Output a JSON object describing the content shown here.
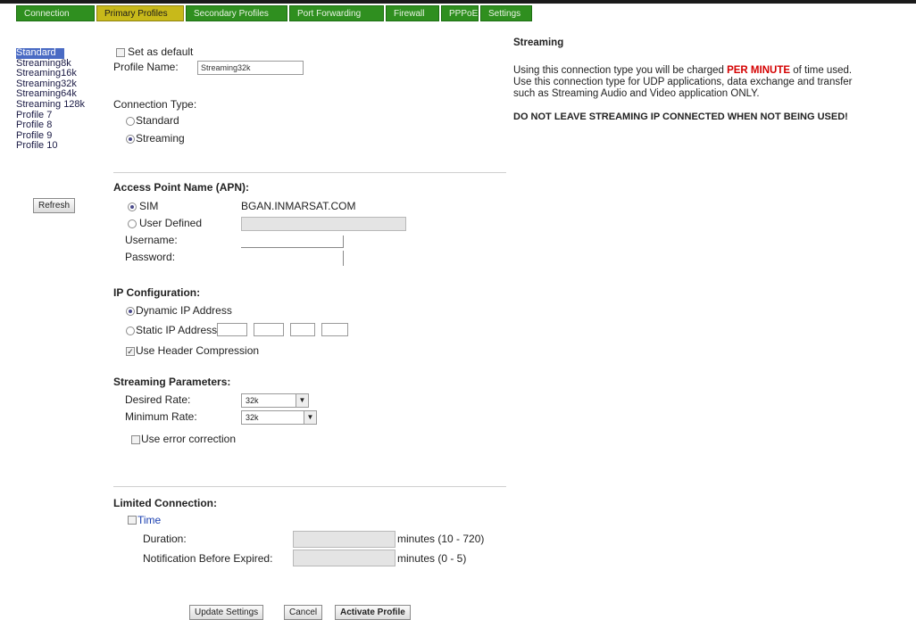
{
  "nav": {
    "tabs": [
      {
        "label": "Connection"
      },
      {
        "label": "Primary Profiles"
      },
      {
        "label": "Secondary Profiles"
      },
      {
        "label": "Port Forwarding"
      },
      {
        "label": "Firewall"
      },
      {
        "label": "PPPoE"
      },
      {
        "label": "Settings"
      }
    ]
  },
  "sidebar": {
    "items": [
      {
        "label": "Standard"
      },
      {
        "label": "Streaming8k"
      },
      {
        "label": "Streaming16k"
      },
      {
        "label": "Streaming32k"
      },
      {
        "label": "Streaming64k"
      },
      {
        "label": "Streaming 128k"
      },
      {
        "label": "Profile 7"
      },
      {
        "label": "Profile 8"
      },
      {
        "label": "Profile 9"
      },
      {
        "label": "Profile 10"
      }
    ],
    "refresh_label": "Refresh"
  },
  "form": {
    "set_default_label": "Set as default",
    "profile_name_label": "Profile Name:",
    "profile_name_value": "Streaming32k",
    "connection_type_label": "Connection Type:",
    "standard_label": "Standard",
    "streaming_label": "Streaming",
    "apn_heading": "Access Point Name (APN):",
    "sim_label": "SIM",
    "sim_value": "BGAN.INMARSAT.COM",
    "user_defined_label": "User Defined",
    "username_label": "Username:",
    "password_label": "Password:",
    "ip_config_heading": "IP Configuration:",
    "dynamic_ip_label": "Dynamic IP Address",
    "static_ip_label": "Static IP Address",
    "header_compression_label": "Use Header Compression",
    "streaming_params_heading": "Streaming Parameters:",
    "desired_rate_label": "Desired Rate:",
    "desired_rate_value": "32k",
    "minimum_rate_label": "Minimum Rate:",
    "minimum_rate_value": "32k",
    "error_correction_label": "Use error correction",
    "limited_heading": "Limited Connection:",
    "time_label": "Time",
    "duration_label": "Duration:",
    "duration_units": "minutes (10 - 720)",
    "notification_label": "Notification Before Expired:",
    "notification_units": "minutes (0 - 5)",
    "update_label": "Update Settings",
    "cancel_label": "Cancel",
    "activate_label": "Activate Profile"
  },
  "info": {
    "title": "Streaming",
    "line1_pre": "Using this connection type you will be charged",
    "line1_highlight": "PER MINUTE",
    "line1_post": "of time used.",
    "line2": "Use this connection type for UDP applications, data exchange and transfer",
    "line3": "such as Streaming Audio and Video application ONLY.",
    "warning": "DO NOT LEAVE STREAMING IP CONNECTED WHEN NOT BEING USED!"
  },
  "colors": {
    "tab_green": "#2f8f1f",
    "tab_active": "#c8b91a",
    "highlight_red": "#d40000",
    "selection_blue": "#4a6bc4"
  }
}
